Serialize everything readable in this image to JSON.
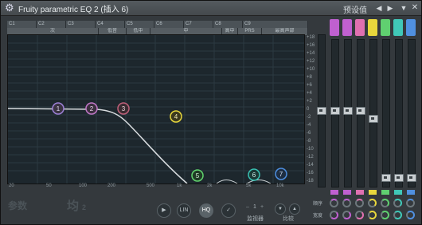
{
  "window": {
    "title": "Fruity parametric EQ 2 (插入 6)",
    "preset_label": "预设值",
    "prev_arrow": "◀",
    "next_arrow": "▶",
    "menu_arrow": "▼"
  },
  "header": {
    "notes": [
      "C1",
      "C2",
      "C3",
      "C4",
      "C5",
      "C6",
      "C7",
      "C8",
      "C9"
    ],
    "ranges": [
      "次",
      "低音",
      "低中",
      "中",
      "高中",
      "PRS",
      "最高声部"
    ]
  },
  "graph": {
    "freq_labels": [
      "20",
      "50",
      "100",
      "200",
      "500",
      "1k",
      "2k",
      "5k",
      "10k"
    ],
    "db_labels": [
      "+18",
      "+16",
      "+14",
      "+12",
      "+10",
      "+8",
      "+6",
      "+4",
      "+2",
      "0",
      "-2",
      "-4",
      "-6",
      "-8",
      "-10",
      "-12",
      "-14",
      "-16",
      "-18"
    ],
    "bands": [
      {
        "n": "1",
        "color": "#9c7fd6"
      },
      {
        "n": "2",
        "color": "#c277c8"
      },
      {
        "n": "3",
        "color": "#c0607a"
      },
      {
        "n": "4",
        "color": "#e8d73c"
      },
      {
        "n": "5",
        "color": "#61d46e"
      },
      {
        "n": "6",
        "color": "#39c2b4"
      },
      {
        "n": "7",
        "color": "#4d8fe0"
      }
    ]
  },
  "faders": {
    "colors": [
      "#c060d0",
      "#c060d0",
      "#e070b0",
      "#e8d73c",
      "#60d070",
      "#40c8b8",
      "#5090e0"
    ],
    "levels": [
      0.0,
      0.0,
      0.0,
      -0.1,
      -0.85,
      -0.85,
      -0.85
    ]
  },
  "bottom": {
    "params_label": "参数",
    "eq_label": "均",
    "eq_sub": "2",
    "play_btn": "▶",
    "lin_btn": "LIN",
    "hq_btn": "HQ",
    "check_btn": "✓",
    "monitor_value": "1",
    "monitor_label": "监视器",
    "compare_label": "比较",
    "order_label": "顺序",
    "width_label": "宽度"
  }
}
